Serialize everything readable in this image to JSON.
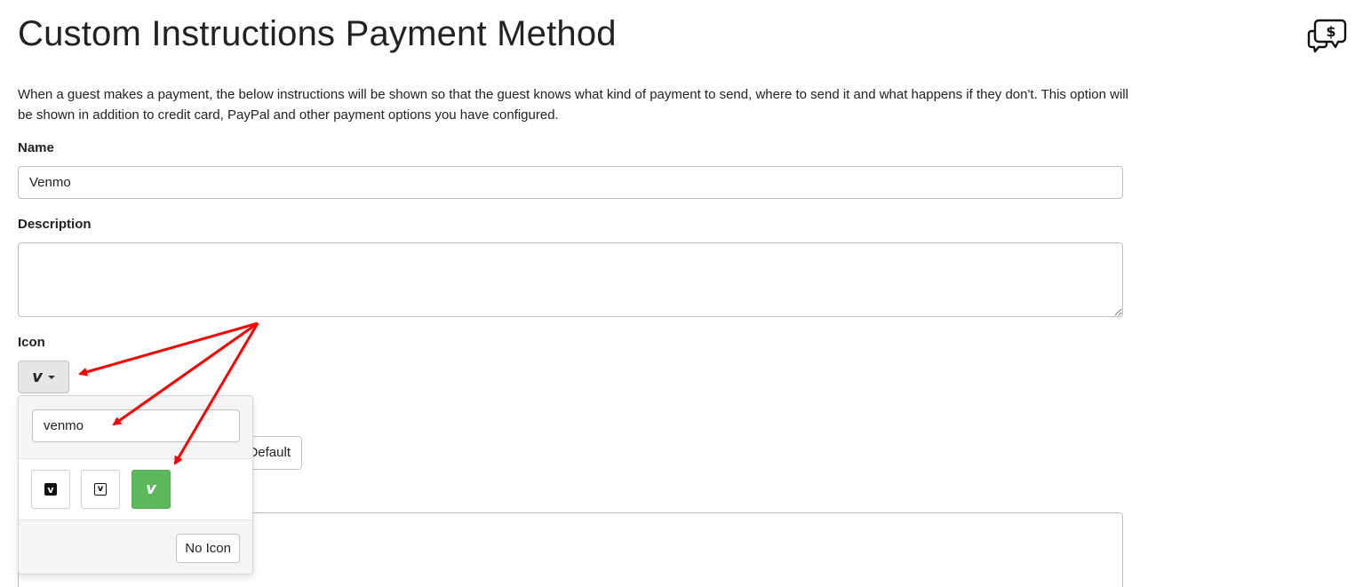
{
  "page": {
    "title": "Custom Instructions Payment Method",
    "intro": "When a guest makes a payment, the below instructions will be shown so that the guest knows what kind of payment to send, where to send it and what happens if they don't. This option will be shown in addition to credit card, PayPal and other payment options you have configured."
  },
  "form": {
    "name_label": "Name",
    "name_value": "Venmo",
    "description_label": "Description",
    "description_value": "",
    "icon_label": "Icon",
    "icon_selected": "venmo-v-icon",
    "default_button": "Default",
    "instructions_value": ""
  },
  "icon_dropdown": {
    "search_value": "venmo",
    "icons": [
      "venmo-square-solid-icon",
      "venmo-square-outline-icon",
      "venmo-v-icon"
    ],
    "selected_icon": "venmo-v-icon",
    "no_icon_label": "No Icon"
  },
  "colors": {
    "selected_tile": "#5cb85c",
    "annotation_arrow": "#ff0000"
  }
}
